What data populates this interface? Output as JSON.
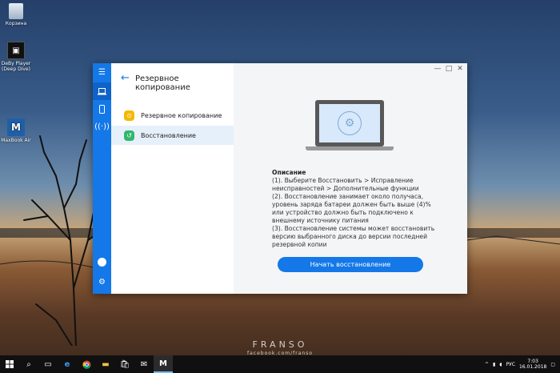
{
  "desktop": {
    "icons": [
      {
        "label": "Корзина"
      },
      {
        "label": "DeBy Player (Deep Dive)"
      },
      {
        "label": "MaxBook Air"
      }
    ]
  },
  "window": {
    "panel_title": "Резервное копирование",
    "menu": [
      {
        "label": "Резервное копирование",
        "color": "#f5b800"
      },
      {
        "label": "Восстановление",
        "color": "#2fb86b"
      }
    ],
    "controls": {
      "minimize": "—",
      "maximize": "□",
      "close": "✕"
    },
    "description": {
      "title": "Описание",
      "lines": [
        "(1). Выберите Восстановить > Исправление неисправностей > Дополнительные функции",
        "(2). Восстановление занимает около получаса, уровень заряда батареи должен быть выше (4)% или устройство должно быть подключено к внешнему источнику питания",
        "(3). Восстановление системы может восстановить версию выбранного диска до версии последней резервной копии"
      ]
    },
    "start_button": "Начать восстановление",
    "accent": "#1478e8"
  },
  "watermark": {
    "brand": "FRANSO",
    "sub": "facebook.com/franso"
  },
  "taskbar": {
    "language": "РУС",
    "time": "7:03",
    "date": "16.01.2018"
  }
}
